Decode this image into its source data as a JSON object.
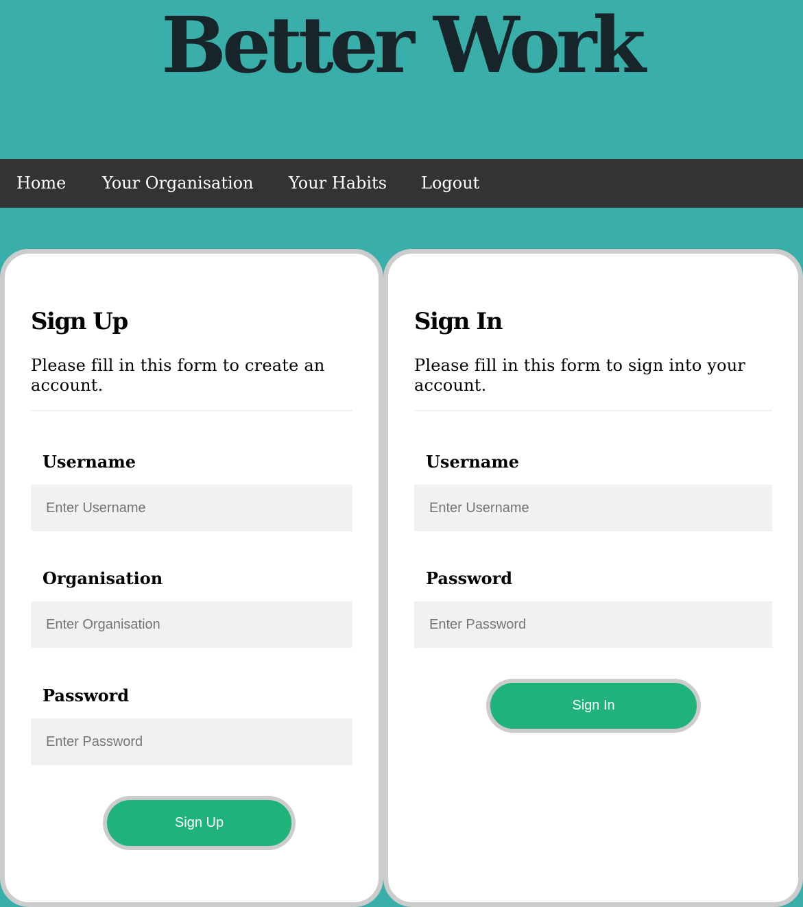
{
  "site": {
    "title": "Better Work"
  },
  "nav": {
    "items": [
      {
        "label": "Home"
      },
      {
        "label": "Your Organisation"
      },
      {
        "label": "Your Habits"
      },
      {
        "label": "Logout"
      }
    ]
  },
  "signup": {
    "title": "Sign Up",
    "description_line1": "Please fill in this form to create an",
    "description_line2": "account.",
    "fields": [
      {
        "label": "Username",
        "placeholder": "Enter Username",
        "value": ""
      },
      {
        "label": "Organisation",
        "placeholder": "Enter Organisation",
        "value": ""
      },
      {
        "label": "Password",
        "placeholder": "Enter Password",
        "value": ""
      }
    ],
    "button_label": "Sign Up"
  },
  "signin": {
    "title": "Sign In",
    "description_line1": "Please fill in this form to sign into your",
    "description_line2": "account.",
    "fields": [
      {
        "label": "Username",
        "placeholder": "Enter Username",
        "value": ""
      },
      {
        "label": "Password",
        "placeholder": "Enter Password",
        "value": ""
      }
    ],
    "button_label": "Sign In"
  },
  "colors": {
    "background": "#3aafa9",
    "title": "#17252a",
    "nav_background": "#333333",
    "card_border": "#cccccc",
    "input_background": "#f1f1f1",
    "button": "#1fb37b"
  }
}
